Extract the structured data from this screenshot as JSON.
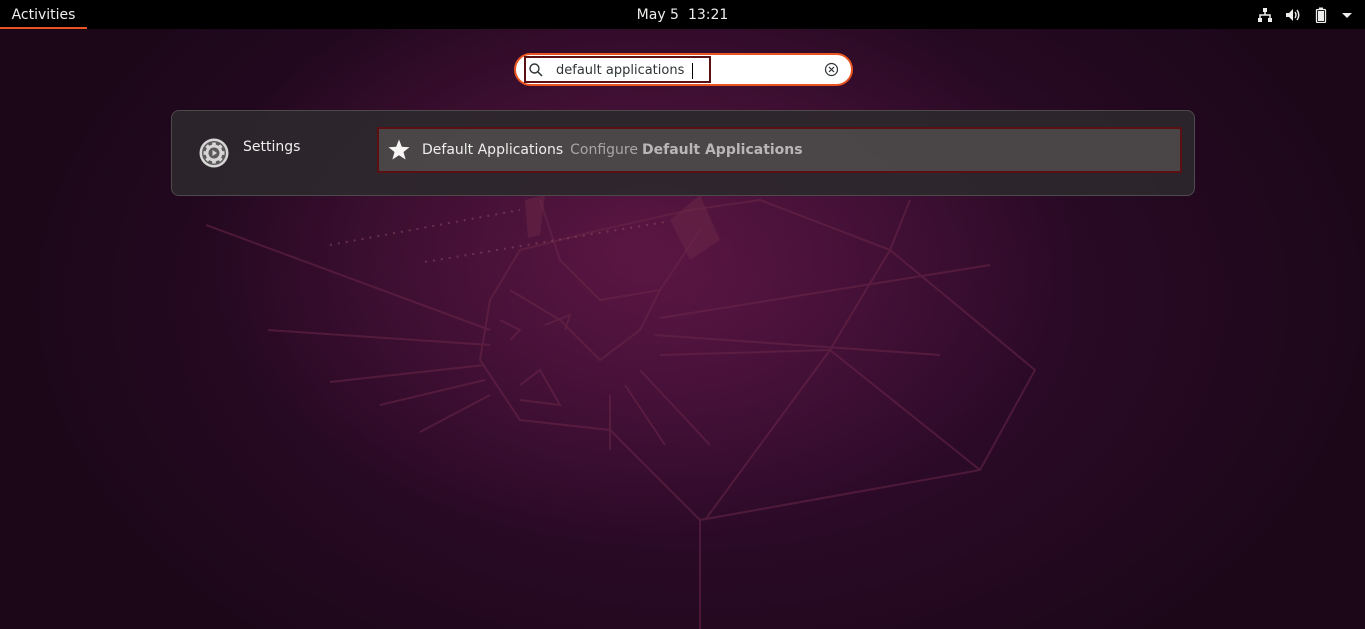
{
  "topbar": {
    "activities_label": "Activities",
    "date": "May 5",
    "time": "13:21",
    "tray_icons": [
      "network-icon",
      "volume-icon",
      "battery-icon",
      "system-menu-arrow-icon"
    ]
  },
  "search": {
    "value": "default applications",
    "icon": "search-icon",
    "clear_icon": "clear-icon"
  },
  "results": {
    "provider": {
      "label": "Settings",
      "icon": "settings-gear-icon"
    },
    "items": [
      {
        "name": "Default Applications",
        "description_prefix": "Configure",
        "description_match": "Default Applications",
        "icon": "star-icon"
      }
    ]
  },
  "colors": {
    "accent": "#e95420",
    "focus_outline": "#5a0f12",
    "topbar": "#000000"
  }
}
